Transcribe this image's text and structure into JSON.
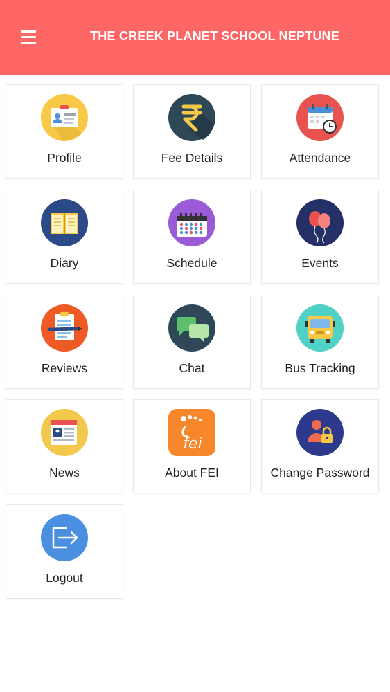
{
  "header": {
    "title": "THE CREEK PLANET SCHOOL NEPTUNE",
    "background_color": "#ff6666",
    "menu_icon": "hamburger-menu-icon"
  },
  "tiles": [
    {
      "label": "Profile",
      "icon": "id-card-icon",
      "color": "#f7c947"
    },
    {
      "label": "Fee Details",
      "icon": "rupee-icon",
      "color": "#2f4858"
    },
    {
      "label": "Attendance",
      "icon": "calendar-clock-icon",
      "color": "#e8534f"
    },
    {
      "label": "Diary",
      "icon": "open-book-icon",
      "color": "#2b4a88"
    },
    {
      "label": "Schedule",
      "icon": "schedule-calendar-icon",
      "color": "#9b5ad6"
    },
    {
      "label": "Events",
      "icon": "balloons-icon",
      "color": "#253067"
    },
    {
      "label": "Reviews",
      "icon": "clipboard-pen-icon",
      "color": "#ee5a24"
    },
    {
      "label": "Chat",
      "icon": "chat-bubbles-icon",
      "color": "#2f4858"
    },
    {
      "label": "Bus Tracking",
      "icon": "bus-icon",
      "color": "#4fd1c5"
    },
    {
      "label": "News",
      "icon": "newspaper-icon",
      "color": "#f2c94c"
    },
    {
      "label": "About FEI",
      "icon": "fei-logo-icon",
      "color": "#f7872a"
    },
    {
      "label": "Change Password",
      "icon": "user-lock-icon",
      "color": "#2d3a8c"
    },
    {
      "label": "Logout",
      "icon": "logout-icon",
      "color": "#4a8fe0"
    }
  ]
}
